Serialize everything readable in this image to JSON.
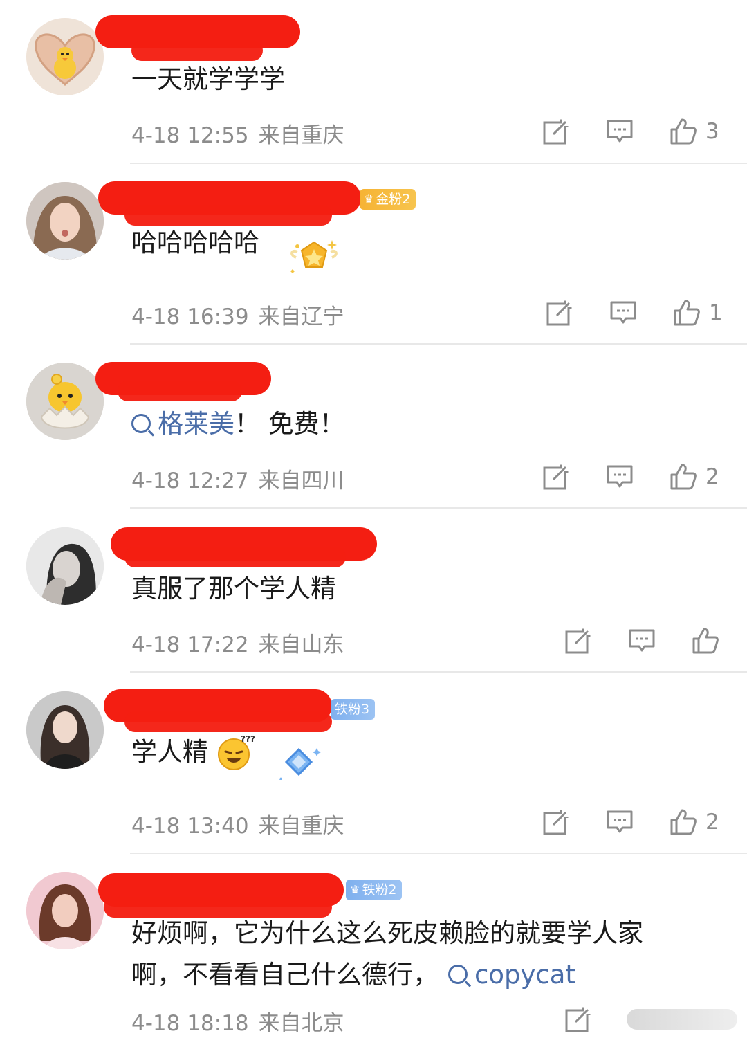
{
  "comments": [
    {
      "text": "一天就学学学",
      "time": "4-18 12:55",
      "location": "来自重庆",
      "likes": "3"
    },
    {
      "badge": "金粉2",
      "text": "哈哈哈哈哈",
      "time": "4-18 16:39",
      "location": "来自辽宁",
      "likes": "1"
    },
    {
      "link": "格莱美",
      "text_after": "！ 免费！",
      "time": "4-18 12:27",
      "location": "来自四川",
      "likes": "2"
    },
    {
      "text": "真服了那个学人精",
      "time": "4-18 17:22",
      "location": "来自山东",
      "likes": ""
    },
    {
      "badge": "铁粉3",
      "text": "学人精",
      "time": "4-18 13:40",
      "location": "来自重庆",
      "likes": "2"
    },
    {
      "badge": "铁粉2",
      "text_line1": "好烦啊，它为什么这么死皮赖脸的就要学人家",
      "text_line2": "啊，不看看自己什么德行，",
      "link": "copycat",
      "time": "4-18 18:18",
      "location": "来自北京"
    }
  ],
  "icons": {
    "repost": "share-icon",
    "comment": "comment-icon",
    "like": "thumbs-up-icon"
  },
  "colors": {
    "redaction": "#f41e12",
    "link": "#4a6da8",
    "meta": "#8c8c8c",
    "gold_badge": "#f6b334",
    "iron_badge": "#7fb0ee"
  }
}
